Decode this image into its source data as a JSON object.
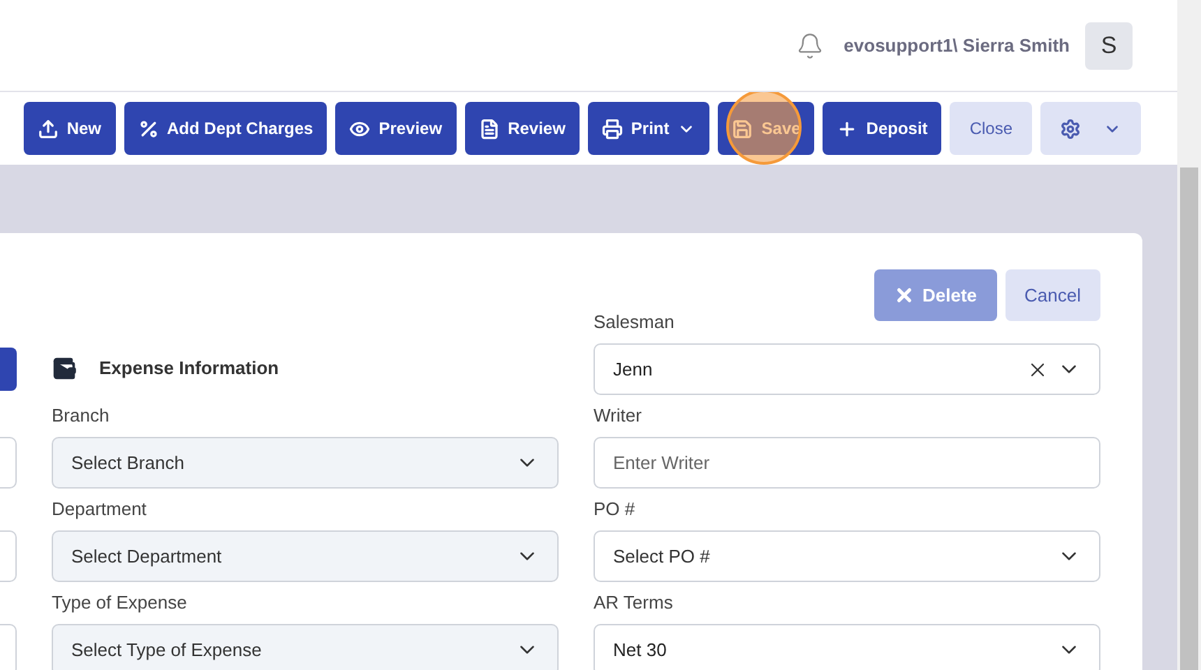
{
  "header": {
    "user": "evosupport1\\ Sierra Smith",
    "avatar": "S"
  },
  "toolbar": [
    {
      "kind": "primary",
      "label": "New",
      "highlighted": false
    },
    {
      "kind": "primary",
      "label": "Add Dept Charges",
      "highlighted": false
    },
    {
      "kind": "primary",
      "label": "Preview",
      "highlighted": false
    },
    {
      "kind": "primary",
      "label": "Review",
      "highlighted": false
    },
    {
      "kind": "dropdown",
      "label": "Print",
      "highlighted": false
    },
    {
      "kind": "primary",
      "label": "Save",
      "highlighted": true
    },
    {
      "kind": "primary",
      "label": "Deposit",
      "highlighted": false
    },
    {
      "kind": "light",
      "label": "Close",
      "highlighted": false
    },
    {
      "kind": "settings",
      "highlighted": false
    }
  ],
  "card": {
    "actions": [
      {
        "kind": "primary",
        "label": "Delete",
        "disabled": true
      },
      {
        "kind": "light",
        "label": "Cancel",
        "disabled": false
      }
    ],
    "section_title": "Expense Information",
    "expense_fields": [
      {
        "kind": "select",
        "label": "Branch",
        "placeholder": "Select Branch",
        "disabled": true
      },
      {
        "kind": "select",
        "label": "Department",
        "placeholder": "Select Department",
        "disabled": true
      },
      {
        "kind": "select",
        "label": "Type of Expense",
        "placeholder": "Select Type of Expense",
        "disabled": true
      }
    ],
    "side_fields": [
      {
        "kind": "select",
        "label": "Salesman",
        "value": "Jenn",
        "clearable": true,
        "disabled": false
      },
      {
        "kind": "text",
        "label": "Writer",
        "placeholder": "Enter Writer",
        "disabled": false
      },
      {
        "kind": "select",
        "label": "PO #",
        "placeholder": "Select PO #",
        "disabled": false
      },
      {
        "kind": "select",
        "label": "AR Terms",
        "value": "Net 30",
        "disabled": false
      }
    ]
  }
}
